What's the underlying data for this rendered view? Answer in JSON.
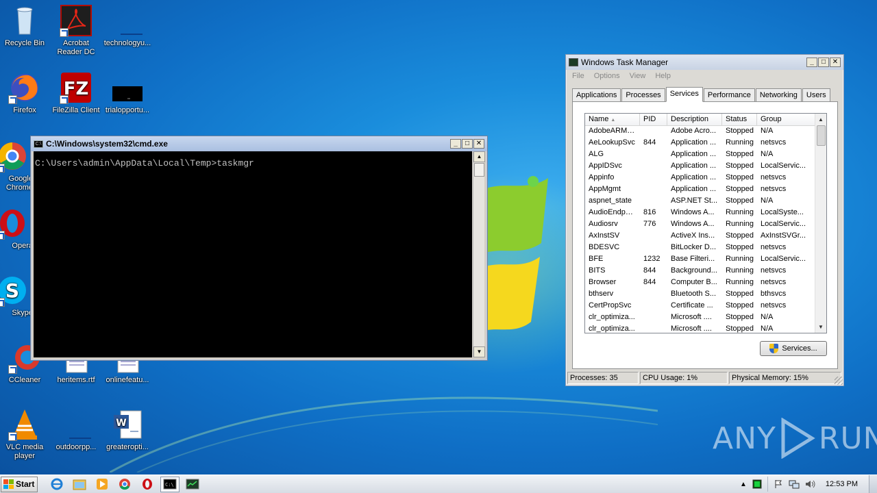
{
  "desktop": {
    "icons": [
      {
        "label": "Recycle Bin"
      },
      {
        "label": "Acrobat Reader DC"
      },
      {
        "label": "technologyu..."
      },
      {
        "label": "Firefox"
      },
      {
        "label": "FileZilla Client"
      },
      {
        "label": "trialopportu..."
      },
      {
        "label": "Google Chrome"
      },
      {
        "label": "Opera"
      },
      {
        "label": "Skype"
      },
      {
        "label": "CCleaner"
      },
      {
        "label": "heritems.rtf"
      },
      {
        "label": "onlinefeatu..."
      },
      {
        "label": "VLC media player"
      },
      {
        "label": "outdoorpp..."
      },
      {
        "label": "greateropti..."
      }
    ]
  },
  "cmd_window": {
    "title": "C:\\Windows\\system32\\cmd.exe",
    "console_text": "C:\\Users\\admin\\AppData\\Local\\Temp>taskmgr"
  },
  "task_manager": {
    "title": "Windows Task Manager",
    "menu": [
      "File",
      "Options",
      "View",
      "Help"
    ],
    "tabs": [
      "Applications",
      "Processes",
      "Services",
      "Performance",
      "Networking",
      "Users"
    ],
    "active_tab": "Services",
    "columns": [
      "Name",
      "PID",
      "Description",
      "Status",
      "Group"
    ],
    "rows": [
      [
        "AdobeARMs...",
        "",
        "Adobe Acro...",
        "Stopped",
        "N/A"
      ],
      [
        "AeLookupSvc",
        "844",
        "Application ...",
        "Running",
        "netsvcs"
      ],
      [
        "ALG",
        "",
        "Application ...",
        "Stopped",
        "N/A"
      ],
      [
        "AppIDSvc",
        "",
        "Application ...",
        "Stopped",
        "LocalServic..."
      ],
      [
        "Appinfo",
        "",
        "Application ...",
        "Stopped",
        "netsvcs"
      ],
      [
        "AppMgmt",
        "",
        "Application ...",
        "Stopped",
        "netsvcs"
      ],
      [
        "aspnet_state",
        "",
        "ASP.NET St...",
        "Stopped",
        "N/A"
      ],
      [
        "AudioEndpoi...",
        "816",
        "Windows A...",
        "Running",
        "LocalSyste..."
      ],
      [
        "Audiosrv",
        "776",
        "Windows A...",
        "Running",
        "LocalServic..."
      ],
      [
        "AxInstSV",
        "",
        "ActiveX Ins...",
        "Stopped",
        "AxInstSVGr..."
      ],
      [
        "BDESVC",
        "",
        "BitLocker D...",
        "Stopped",
        "netsvcs"
      ],
      [
        "BFE",
        "1232",
        "Base Filteri...",
        "Running",
        "LocalServic..."
      ],
      [
        "BITS",
        "844",
        "Background...",
        "Running",
        "netsvcs"
      ],
      [
        "Browser",
        "844",
        "Computer B...",
        "Running",
        "netsvcs"
      ],
      [
        "bthserv",
        "",
        "Bluetooth S...",
        "Stopped",
        "bthsvcs"
      ],
      [
        "CertPropSvc",
        "",
        "Certificate ...",
        "Stopped",
        "netsvcs"
      ],
      [
        "clr_optimiza...",
        "",
        "Microsoft ....",
        "Stopped",
        "N/A"
      ],
      [
        "clr_optimiza...",
        "",
        "Microsoft ....",
        "Stopped",
        "N/A"
      ]
    ],
    "services_button": "Services...",
    "status": {
      "processes": "Processes: 35",
      "cpu": "CPU Usage: 1%",
      "memory": "Physical Memory: 15%"
    }
  },
  "watermark": {
    "left": "ANY",
    "right": "RUN"
  },
  "taskbar": {
    "start_label": "Start",
    "clock": "12:53 PM"
  }
}
